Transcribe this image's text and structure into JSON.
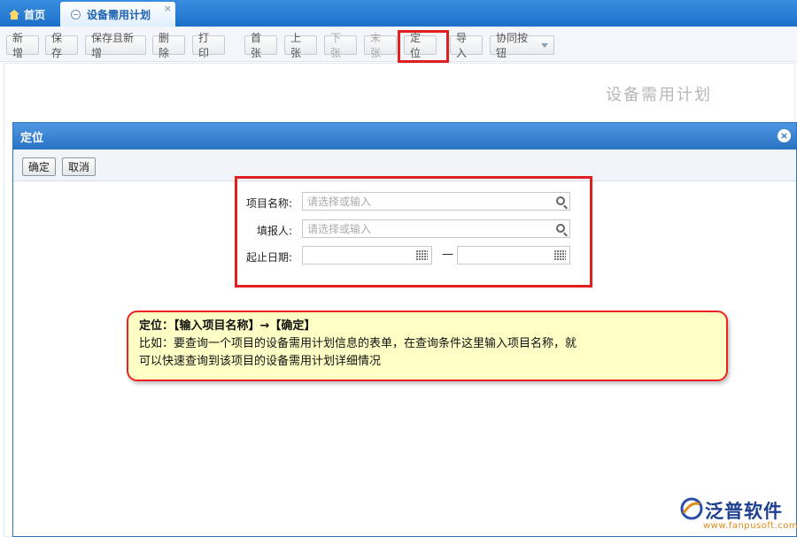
{
  "tabs": [
    {
      "label": "首页",
      "icon": "home-icon"
    },
    {
      "label": "设备需用计划",
      "icon": "page-icon",
      "active": true
    }
  ],
  "tab_close": "×",
  "toolbar": {
    "buttons": [
      {
        "label": "新增",
        "enabled": true
      },
      {
        "label": "保存",
        "enabled": true
      },
      {
        "label": "保存且新增",
        "enabled": true
      },
      {
        "label": "删除",
        "enabled": true
      },
      {
        "label": "打印",
        "enabled": true
      },
      {
        "label": "首张",
        "enabled": true
      },
      {
        "label": "上张",
        "enabled": true
      },
      {
        "label": "下张",
        "enabled": false
      },
      {
        "label": "末张",
        "enabled": false
      },
      {
        "label": "定位",
        "enabled": true,
        "highlighted": true
      },
      {
        "label": "导入",
        "enabled": true
      },
      {
        "label": "协同按钮",
        "enabled": true,
        "dropdown": true
      }
    ]
  },
  "page_title": "设备需用计划",
  "dialog": {
    "title": "定位",
    "close": "×",
    "confirm_label": "确定",
    "cancel_label": "取消",
    "fields": {
      "project_label": "项目名称:",
      "project_placeholder": "请选择或输入",
      "reporter_label": "填报人:",
      "reporter_placeholder": "请选择或输入",
      "date_label": "起止日期:",
      "date_separator": "—"
    }
  },
  "callout": {
    "line1": "定位：【输入项目名称】→【确定】",
    "line2": "比如：要查询一个项目的设备需用计划信息的表单，在查询条件这里输入项目名称，就",
    "line3": "可以快速查询到该项目的设备需用计划详细情况"
  },
  "logo": {
    "name": "泛普软件",
    "url": "www.fanpusoft.com"
  },
  "colors": {
    "highlight": "#e02020",
    "header_blue": "#2a73c4",
    "callout_bg": "#ffffc6"
  }
}
